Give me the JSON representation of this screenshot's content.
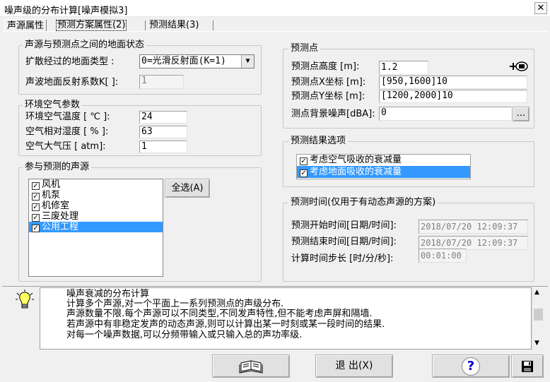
{
  "window": {
    "title": "噪声级的分布计算[噪声模拟3]",
    "close_glyph": "✕"
  },
  "tabs": [
    {
      "label": "声源属性"
    },
    {
      "label": "预测方案属性(2)"
    },
    {
      "label": "预测结果(3)"
    }
  ],
  "ground": {
    "title": "声源与预测点之间的地面状态",
    "ground_type_label": "扩散经过的地面类型   :",
    "ground_type_value": "0=光滑反射面(K=1)",
    "reflect_label": "声波地面反射系数K[ ]:",
    "reflect_value": "1"
  },
  "env": {
    "title": "环境空气参数",
    "temp_label": "环境空气温度  [ ℃ ]:",
    "temp_value": "24",
    "humidity_label": "空气相对湿度  [  % ]:",
    "humidity_value": "63",
    "pressure_label": "空气大气压    [ atm]:",
    "pressure_value": "1"
  },
  "sources": {
    "title": "参与预测的声源",
    "select_all_label": "全选(A)",
    "items": [
      {
        "label": "风机",
        "checked": true
      },
      {
        "label": "机泵",
        "checked": true
      },
      {
        "label": "机修室",
        "checked": true
      },
      {
        "label": "三废处理",
        "checked": true
      },
      {
        "label": "公用工程",
        "checked": true,
        "selected": true
      }
    ]
  },
  "point": {
    "title": "预测点",
    "height_label": "预测点高度  [m]:",
    "height_value": "1.2",
    "x_label": "预测点X坐标  [m]:",
    "x_value": "[950,1600]10",
    "y_label": "预测点Y坐标  [m]:",
    "y_value": "[1200,2000]10",
    "bg_label": "测点背景噪声[dBA]:",
    "bg_value": "0",
    "browse_label": "..."
  },
  "options": {
    "title": "预测结果选项",
    "items": [
      {
        "label": "考虑空气吸收的衰减量",
        "checked": true
      },
      {
        "label": "考虑地面吸收的衰减量",
        "checked": true,
        "selected": true
      }
    ]
  },
  "time": {
    "title": "预测时间(仅用于有动态声源的方案)",
    "start_label": "预测开始时间[日期/时间]:",
    "start_value": "2018/07/20 12:09:37",
    "end_label": "预测结束时间[日期/时间]:",
    "end_value": "2018/07/20 12:09:37",
    "step_label": "计算时间步长 [时/分/秒]:",
    "step_value": "00:01:00"
  },
  "description": {
    "lines": [
      "噪声衰减的分布计算",
      "计算多个声源,对一个平面上一系列预测点的声级分布.",
      "声源数量不限.每个声源可以不同类型,不同发声特性,但不能考虑声屏和隔墙.",
      "若声源中有非稳定发声的动态声源,则可以计算出某一时刻或某一段时间的结果.",
      "对每一个噪声数据,可以分频带输入或只输入总的声功率级."
    ]
  },
  "buttons": {
    "exit_label": "退 出(X)",
    "help_glyph": "?"
  },
  "colors": {
    "selection": "#3399ff",
    "help_blue": "#0000cc"
  }
}
